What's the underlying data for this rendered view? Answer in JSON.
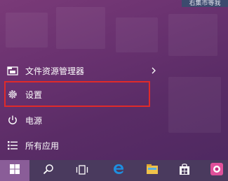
{
  "top_badge": {
    "text": "右集市等我"
  },
  "start_menu": {
    "items": [
      {
        "label": "文件资源管理器",
        "icon": "folder-icon",
        "has_submenu": true
      },
      {
        "label": "设置",
        "icon": "gear-icon",
        "highlighted": true
      },
      {
        "label": "电源",
        "icon": "power-icon"
      },
      {
        "label": "所有应用",
        "icon": "list-icon"
      }
    ]
  },
  "taskbar": {
    "buttons": [
      "windows-logo-icon",
      "search-icon",
      "task-view-icon",
      "edge-icon",
      "file-explorer-icon",
      "store-icon",
      "app-icon"
    ]
  },
  "colors": {
    "background": "#6a3270",
    "highlight_border": "#e02a2a",
    "taskbar": "#4a3a5e",
    "start_button": "#8a5d98"
  }
}
